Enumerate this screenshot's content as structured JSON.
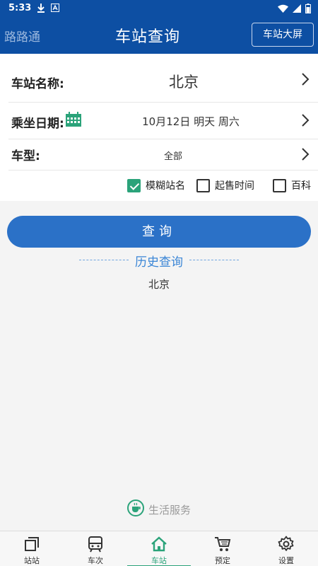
{
  "status_bar": {
    "time": "5:33"
  },
  "header": {
    "app_name": "路路通",
    "title": "车站查询",
    "big_screen_label": "车站大屏"
  },
  "form": {
    "station": {
      "label": "车站名称:",
      "value": "北京"
    },
    "date": {
      "label": "乘坐日期:",
      "value": "10月12日 明天 周六"
    },
    "train_type": {
      "label": "车型:",
      "value": "全部"
    }
  },
  "options": [
    {
      "label": "模糊站名",
      "checked": true
    },
    {
      "label": "起售时间",
      "checked": false
    },
    {
      "label": "百科",
      "checked": false
    }
  ],
  "query_button": "查询",
  "history": {
    "title": "历史查询",
    "items": [
      "北京"
    ]
  },
  "life_service": "生活服务",
  "tabs": [
    {
      "label": "站站",
      "icon": "station-to-station-icon"
    },
    {
      "label": "车次",
      "icon": "train-icon"
    },
    {
      "label": "车站",
      "icon": "home-station-icon",
      "active": true
    },
    {
      "label": "预定",
      "icon": "cart-icon"
    },
    {
      "label": "设置",
      "icon": "gear-icon"
    }
  ],
  "colors": {
    "primary": "#0d4fa3",
    "button": "#2b71c7",
    "accent": "#2ba37a",
    "history": "#3b86d6"
  }
}
